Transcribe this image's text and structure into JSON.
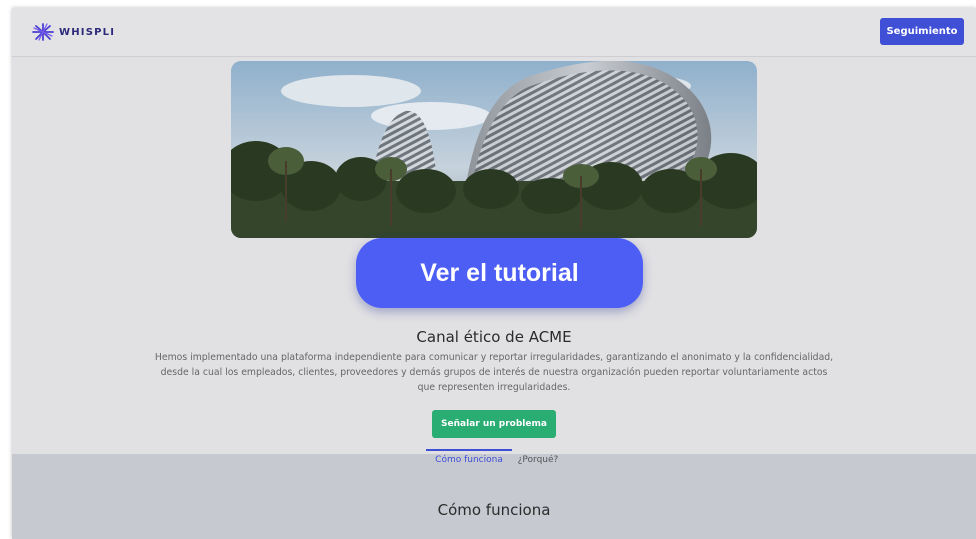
{
  "navbar": {
    "logo_text": "WHISPLI",
    "follow_button_label": "Seguimiento"
  },
  "hero": {
    "tutorial_button_label": "Ver el tutorial"
  },
  "main": {
    "title": "Canal ético de ACME",
    "description": "Hemos implementado una plataforma independiente para comunicar y reportar irregularidades, garantizando el anonimato y la confidencialidad, desde la cual los empleados, clientes, proveedores y demás grupos de interés de nuestra organización pueden reportar voluntariamente actos que representen irregularidades.",
    "report_button_label": "Señalar un problema"
  },
  "tabs": [
    {
      "label": "Cómo funciona",
      "active": true
    },
    {
      "label": "¿Porqué?",
      "active": false
    }
  ],
  "section": {
    "title": "Cómo funciona"
  },
  "colors": {
    "primary": "#3f4fd6",
    "tutorial": "#4d5ef5",
    "success": "#29ad72",
    "overlay_bg": "#e1e1e3",
    "section_bg": "#c7c9d1"
  },
  "icons": {
    "logo": "whispli-starburst-icon"
  }
}
